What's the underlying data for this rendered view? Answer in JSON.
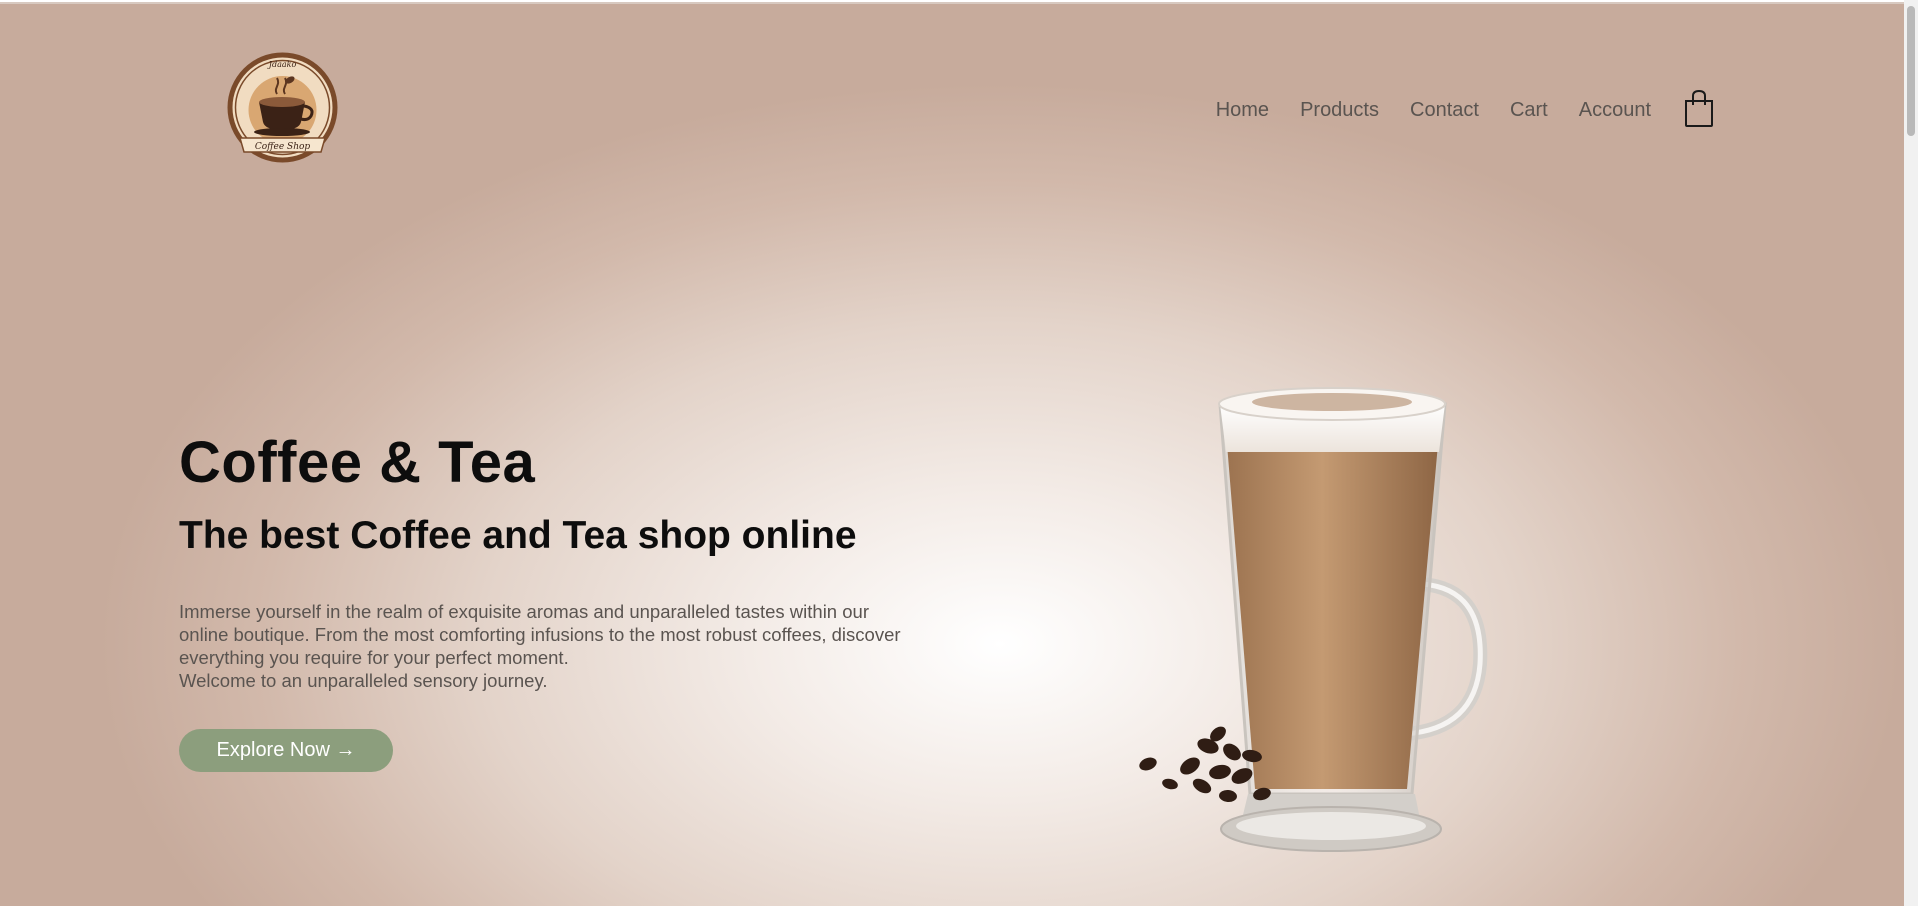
{
  "nav": {
    "items": [
      {
        "label": "Home"
      },
      {
        "label": "Products"
      },
      {
        "label": "Contact"
      },
      {
        "label": "Cart"
      },
      {
        "label": "Account"
      }
    ],
    "cart_icon": "shopping-bag-icon"
  },
  "logo": {
    "top_text": "Jdaako",
    "bottom_text": "Coffee Shop",
    "icon": "coffee-cup-logo"
  },
  "hero": {
    "title": "Coffee & Tea",
    "subtitle": "The best Coffee and Tea shop online",
    "description_lines": [
      "Immerse yourself in the realm of exquisite aromas and unparalleled tastes within our",
      "online boutique. From the most comforting infusions to the most robust coffees, discover",
      "everything you require for your perfect moment.",
      "Welcome to an unparalleled sensory journey."
    ],
    "cta_label": "Explore Now →"
  },
  "colors": {
    "accent_button": "#8c9e7d",
    "nav_text": "#5a5450",
    "heading": "#0d0d0d",
    "background_edge": "#c7ab9c",
    "background_center": "#ffffff"
  }
}
